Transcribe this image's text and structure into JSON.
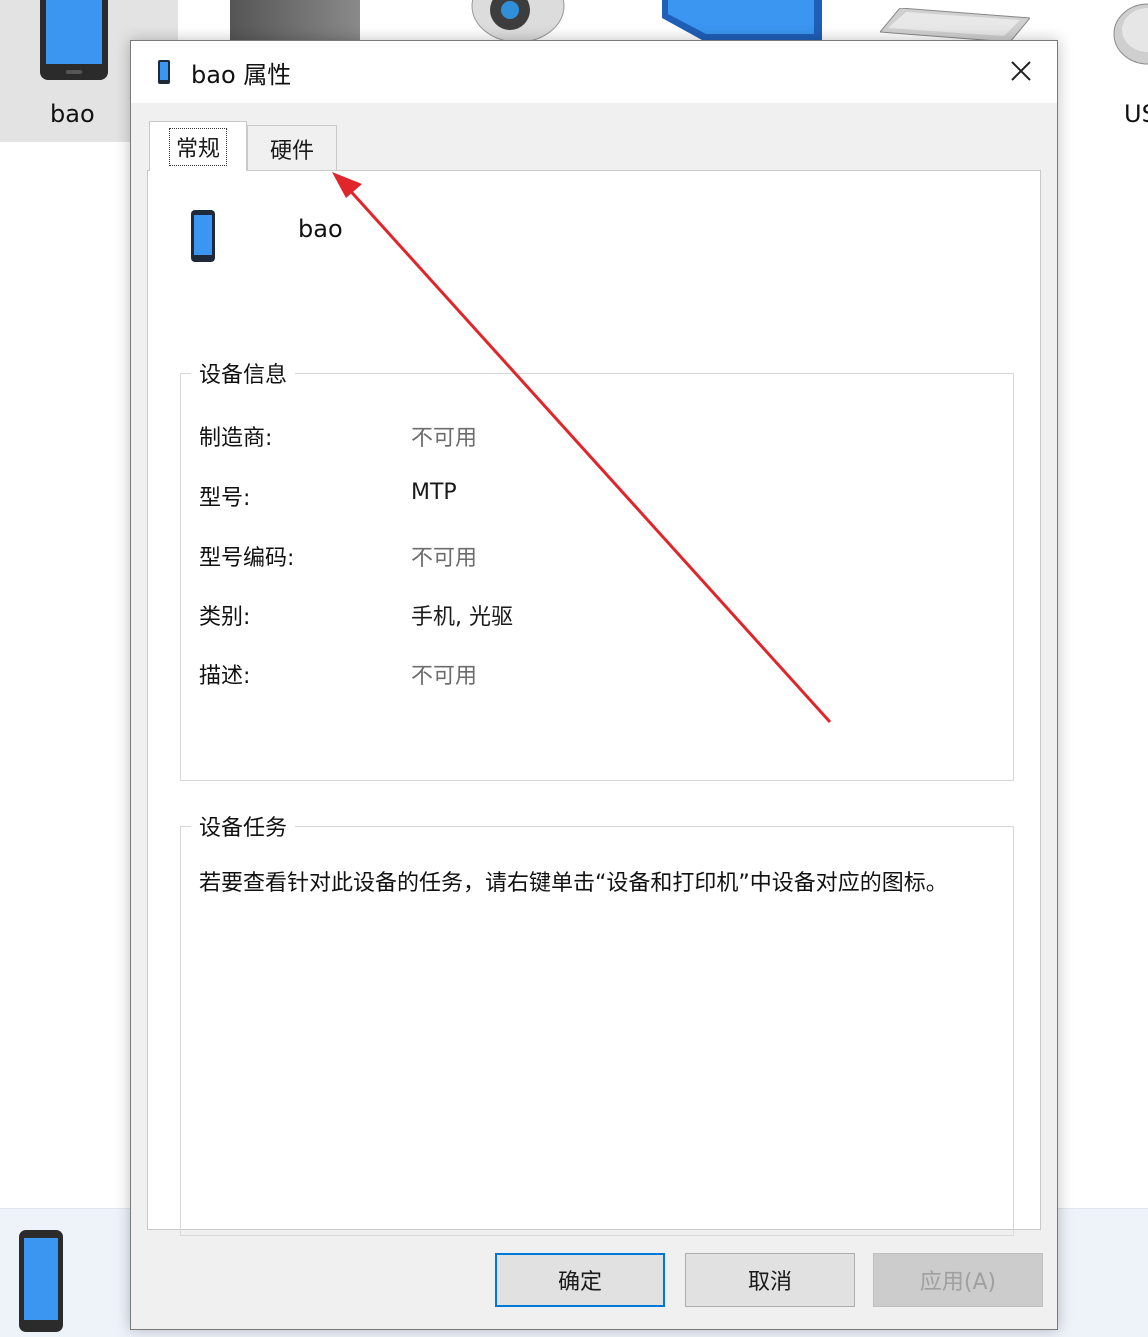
{
  "background": {
    "selected_device_label": "bao",
    "partial_device_label": "US"
  },
  "dialog": {
    "title": "bao 属性",
    "tabs": [
      {
        "label": "常规",
        "active": true
      },
      {
        "label": "硬件",
        "active": false
      }
    ],
    "device_name": "bao",
    "device_info": {
      "title": "设备信息",
      "rows": [
        {
          "label": "制造商:",
          "value": "不可用"
        },
        {
          "label": "型号:",
          "value": "MTP"
        },
        {
          "label": "型号编码:",
          "value": "不可用"
        },
        {
          "label": "类别:",
          "value": "手机, 光驱"
        },
        {
          "label": "描述:",
          "value": "不可用"
        }
      ]
    },
    "device_tasks": {
      "title": "设备任务",
      "text": "若要查看针对此设备的任务，请右键单击“设备和打印机”中设备对应的图标。"
    },
    "buttons": {
      "ok": "确定",
      "cancel": "取消",
      "apply": "应用(A)"
    }
  },
  "colors": {
    "annotation_arrow": "#e0252b",
    "default_button_border": "#0078d7",
    "phone_icon_screen": "#3a96f0"
  }
}
